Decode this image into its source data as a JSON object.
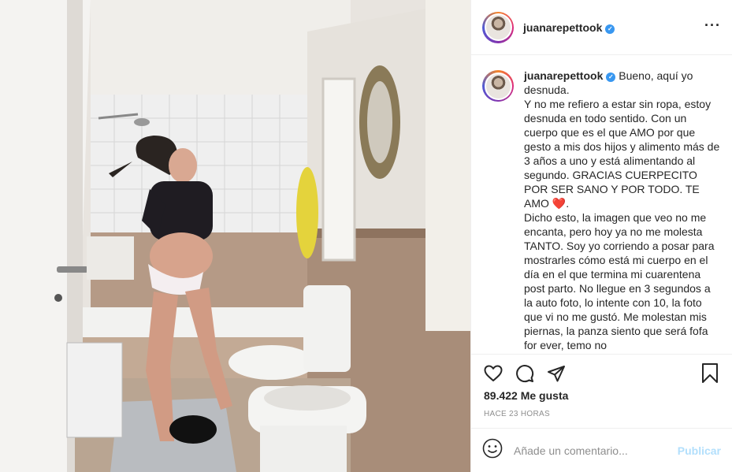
{
  "post": {
    "username": "juanarepettook",
    "verified_mark": "✓",
    "more_icon": "more-options-icon",
    "caption_text": " Bueno, aquí yo desnuda.\nY no me refiero a estar sin ropa, estoy desnuda en todo sentido. Con un cuerpo que es el que AMO por que gesto a mis dos hijos y alimento más de 3 años a uno y está alimentando al segundo. GRACIAS CUERPECITO POR SER SANO Y POR TODO. TE AMO ",
    "caption_heart": "❤️",
    "caption_text_2": ".\nDicho esto, la imagen que veo no me encanta, pero hoy ya no me molesta TANTO. Soy yo corriendo a posar para mostrarles cómo está mi cuerpo en el día en el que termina mi cuarentena post parto. No llegue en 3 segundos a la auto foto, lo intente con 10, la foto que vi no me gustó. Me molestan mis piernas, la panza siento que será fofa for ever, temo no",
    "likes": "89.422 Me gusta",
    "time_ago": "HACE 23 HORAS",
    "comment_placeholder": "Añade un comentario...",
    "publish_label": "Publicar"
  },
  "icons": {
    "like": "heart-icon",
    "comment": "comment-icon",
    "share": "share-icon",
    "save": "bookmark-icon",
    "emoji": "emoji-icon"
  },
  "colors": {
    "verified": "#3897f0",
    "publish_disabled": "#b2dffc",
    "secondary_text": "#8e8e8e"
  }
}
